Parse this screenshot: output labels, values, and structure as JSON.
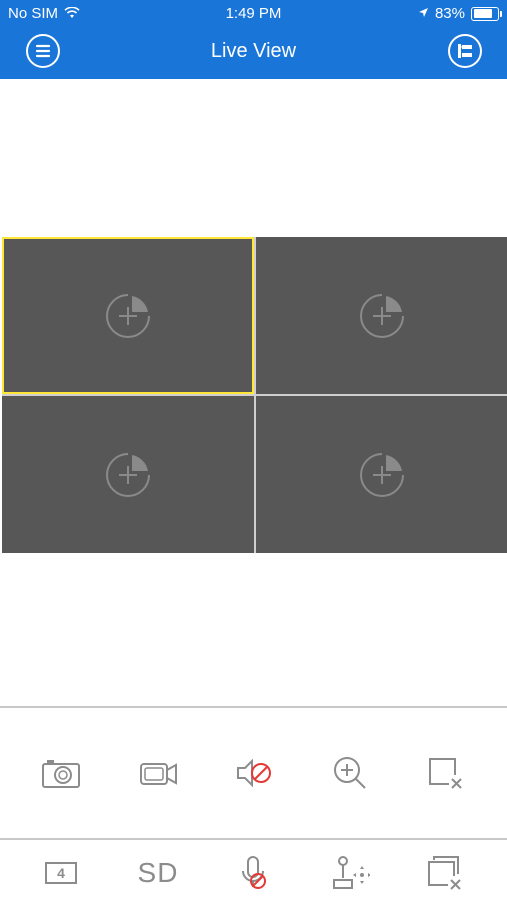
{
  "status_bar": {
    "carrier": "No SIM",
    "time": "1:49 PM",
    "battery": "83%",
    "battery_level": 0.83
  },
  "header": {
    "title": "Live View",
    "left_icon": "menu-icon",
    "right_icon": "device-list-icon",
    "color": "#1a75d8"
  },
  "grid": {
    "cells": [
      {
        "icon": "add-camera-icon",
        "selected": true
      },
      {
        "icon": "add-camera-icon",
        "selected": false
      },
      {
        "icon": "add-camera-icon",
        "selected": false
      },
      {
        "icon": "add-camera-icon",
        "selected": false
      }
    ],
    "selected_color": "#ffe637"
  },
  "toolbar_top": [
    {
      "icon": "snapshot-icon"
    },
    {
      "icon": "record-icon"
    },
    {
      "icon": "audio-muted-icon"
    },
    {
      "icon": "digital-zoom-icon"
    },
    {
      "icon": "close-window-icon"
    }
  ],
  "toolbar_bottom": {
    "window_count": "4",
    "stream_label": "SD",
    "items": [
      {
        "icon": "window-count-icon"
      },
      {
        "icon": "stream-quality-icon"
      },
      {
        "icon": "talk-disabled-icon"
      },
      {
        "icon": "ptz-icon"
      },
      {
        "icon": "close-all-icon"
      }
    ]
  }
}
